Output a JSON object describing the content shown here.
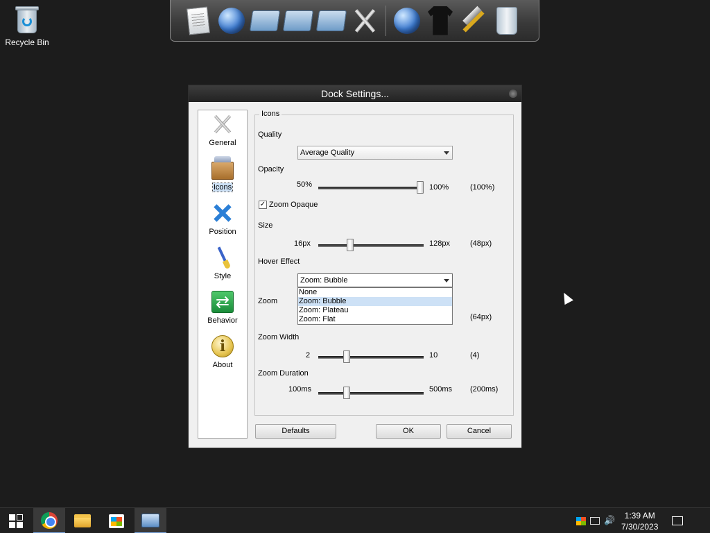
{
  "desktop": {
    "recycle_bin_label": "Recycle Bin"
  },
  "dock": {
    "items": [
      "document-icon",
      "globe-document-icon",
      "folder-icon",
      "music-folder-icon",
      "pictures-folder-icon",
      "tools-icon",
      "internet-globe-icon",
      "tshirt-icon",
      "hammer-icon",
      "recycle-bin-icon"
    ]
  },
  "dialog": {
    "title": "Dock Settings...",
    "nav": [
      {
        "label": "General",
        "icon": "wrench-screwdriver-icon"
      },
      {
        "label": "Icons",
        "icon": "box-icon",
        "selected": true
      },
      {
        "label": "Position",
        "icon": "arrows-cross-icon"
      },
      {
        "label": "Style",
        "icon": "paintbrush-icon"
      },
      {
        "label": "Behavior",
        "icon": "arrows-swap-icon"
      },
      {
        "label": "About",
        "icon": "info-icon"
      }
    ],
    "group_title": "Icons",
    "quality": {
      "label": "Quality",
      "value": "Average Quality"
    },
    "opacity": {
      "label": "Opacity",
      "min": "50%",
      "max": "100%",
      "current": "(100%)",
      "value_fraction": 1.0
    },
    "zoom_opaque": {
      "label": "Zoom Opaque",
      "checked": true,
      "mark": "✓"
    },
    "size": {
      "label": "Size",
      "min": "16px",
      "max": "128px",
      "current": "(48px)",
      "value_fraction": 0.29
    },
    "hover_effect": {
      "label": "Hover Effect",
      "value": "Zoom: Bubble",
      "options": [
        "None",
        "Zoom: Bubble",
        "Zoom: Plateau",
        "Zoom: Flat"
      ],
      "highlighted": "Zoom: Bubble"
    },
    "zoom": {
      "label": "Zoom",
      "current": "(64px)"
    },
    "zoom_width": {
      "label": "Zoom Width",
      "min": "2",
      "max": "10",
      "current": "(4)",
      "value_fraction": 0.25
    },
    "zoom_duration": {
      "label": "Zoom Duration",
      "min": "100ms",
      "max": "500ms",
      "current": "(200ms)",
      "value_fraction": 0.25
    },
    "buttons": {
      "defaults": "Defaults",
      "ok": "OK",
      "cancel": "Cancel"
    }
  },
  "taskbar": {
    "apps": [
      "start-icon",
      "chrome-icon",
      "file-explorer-icon",
      "store-icon",
      "remote-desktop-icon"
    ],
    "clock": {
      "time": "1:39 AM",
      "date": "7/30/2023"
    }
  }
}
